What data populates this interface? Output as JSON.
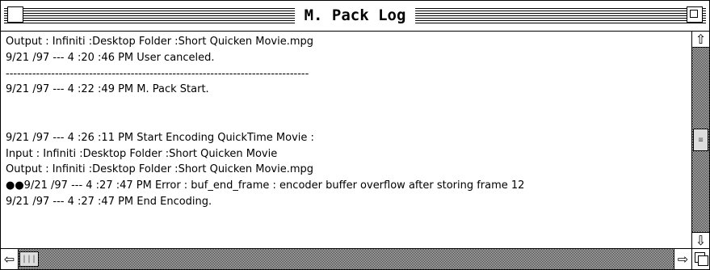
{
  "window": {
    "title": "M. Pack Log"
  },
  "log": {
    "lines": [
      "Output : Infiniti :Desktop Folder :Short Quicken Movie.mpg",
      "9/21 /97 --- 4 :20 :46 PM User canceled.",
      "--------------------------------------------------------------------------------",
      "9/21 /97 --- 4 :22 :49 PM M. Pack Start.",
      "",
      "",
      "9/21 /97 --- 4 :26 :11 PM Start Encoding QuickTime Movie :",
      "Input : Infiniti :Desktop Folder :Short Quicken Movie",
      "Output : Infiniti :Desktop Folder :Short Quicken Movie.mpg",
      "●●9/21 /97 --- 4 :27 :47 PM Error : buf_end_frame  : encoder buffer overflow after storing frame 12",
      "9/21 /97 --- 4 :27 :47 PM End Encoding."
    ]
  },
  "icons": {
    "close": "close-box-icon",
    "zoom": "zoom-box-icon",
    "up": "⇧",
    "down": "⇩",
    "left": "⇦",
    "right": "⇨",
    "vthumb": "≡",
    "hthumb": "|||"
  }
}
